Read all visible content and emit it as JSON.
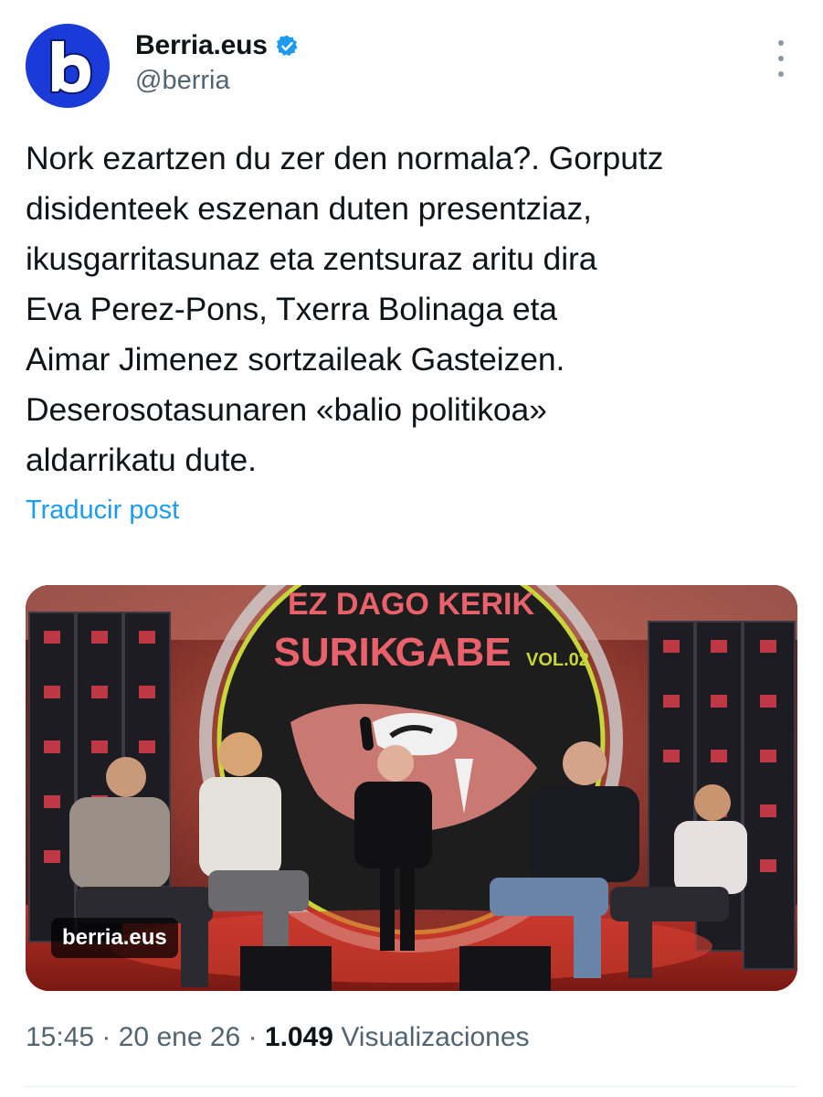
{
  "account": {
    "display_name": "Berria.eus",
    "handle": "@berria",
    "avatar_letter": "b",
    "brand_color": "#1a3bd8",
    "verified_color": "#1d9bf0"
  },
  "post": {
    "text": "Nork ezartzen du zer den normala?. Gorputz\ndisidenteek eszenan duten presentziaz,\nikusgarritasunaz eta zentsuraz aritu dira\nEva Perez-Pons, Txerra Bolinaga eta\nAimar Jimenez sortzaileak Gasteizen.\nDeserosotasunaren «balio politikoa»\naldarrikatu dute.",
    "translate_label": "Traducir post"
  },
  "media": {
    "source_label": "berria.eus",
    "poster_line1": "EZ DAGO KERIK",
    "poster_line2": "SURIK",
    "poster_line3": "GABE",
    "poster_vol": "VOL.02"
  },
  "meta": {
    "time": "15:45",
    "date": "20 ene 26",
    "views_count": "1.049",
    "views_label": "Visualizaciones"
  },
  "icons": {
    "more": "more-vertical-icon",
    "verified": "verified-badge-icon"
  }
}
